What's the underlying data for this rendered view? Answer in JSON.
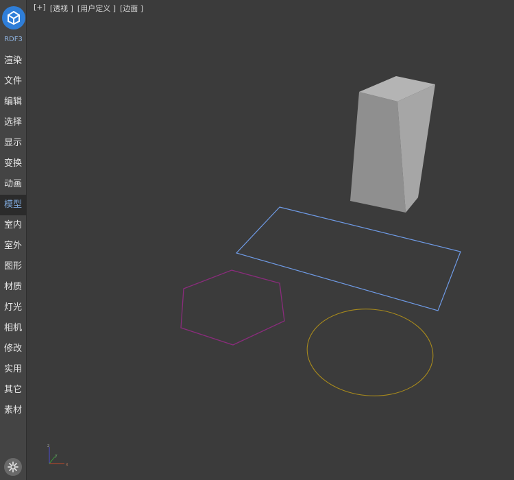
{
  "brand": {
    "name": "RDF3"
  },
  "menu": {
    "items": [
      {
        "label": "渲染",
        "active": false
      },
      {
        "label": "文件",
        "active": false
      },
      {
        "label": "编辑",
        "active": false
      },
      {
        "label": "选择",
        "active": false
      },
      {
        "label": "显示",
        "active": false
      },
      {
        "label": "变换",
        "active": false
      },
      {
        "label": "动画",
        "active": false
      },
      {
        "label": "模型",
        "active": true
      },
      {
        "label": "室内",
        "active": false
      },
      {
        "label": "室外",
        "active": false
      },
      {
        "label": "图形",
        "active": false
      },
      {
        "label": "材质",
        "active": false
      },
      {
        "label": "灯光",
        "active": false
      },
      {
        "label": "相机",
        "active": false
      },
      {
        "label": "修改",
        "active": false
      },
      {
        "label": "实用",
        "active": false
      },
      {
        "label": "其它",
        "active": false
      },
      {
        "label": "素材",
        "active": false
      }
    ]
  },
  "viewport": {
    "labels": [
      "[+]",
      "[透视 ]",
      "[用户定义 ]",
      "[边面 ]"
    ],
    "axis": {
      "x": "x",
      "y": "y",
      "z": "z"
    }
  },
  "colors": {
    "accent": "#2f7ed8",
    "active_text": "#7ea7d8",
    "rectangle": "#6f9be6",
    "hexagon": "#8a2c7c",
    "circle": "#a88a1c",
    "box": "#9a9a9a"
  },
  "icons": [
    "logo-icon",
    "settings-gear-icon",
    "axis-gizmo-icon"
  ]
}
